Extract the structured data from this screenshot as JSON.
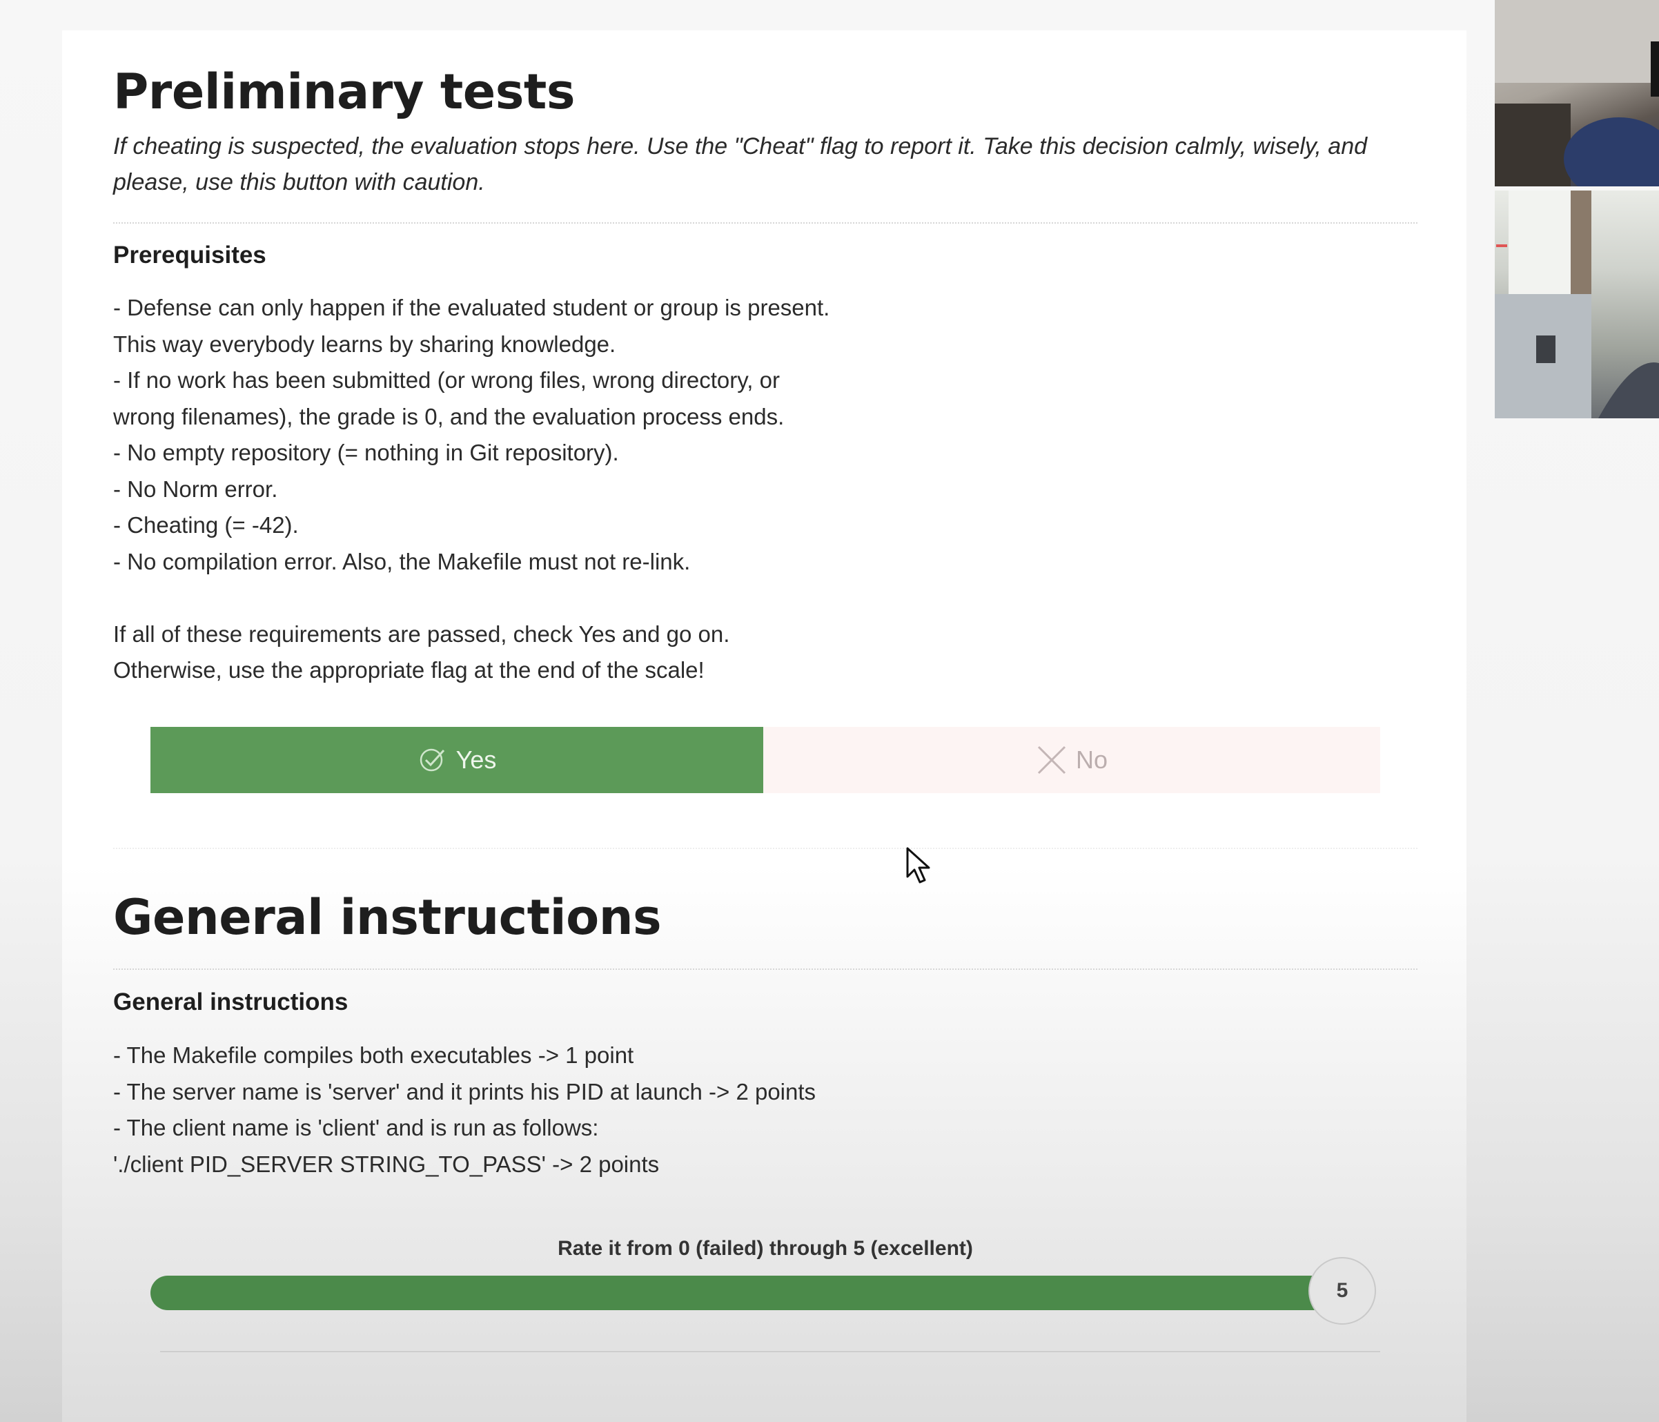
{
  "preliminary": {
    "title": "Preliminary tests",
    "intro": "If cheating is suspected, the evaluation stops here. Use the \"Cheat\" flag to report it. Take this decision calmly, wisely, and please, use this button with caution.",
    "subheading": "Prerequisites",
    "lines": [
      "- Defense can only happen if the evaluated student or group is present.",
      "This way everybody learns by sharing knowledge.",
      "- If no work has been submitted (or wrong files, wrong directory, or",
      "wrong filenames), the grade is 0, and the evaluation process ends.",
      "- No empty repository (= nothing in Git repository).",
      "- No Norm error.",
      "- Cheating (= -42).",
      "- No compilation error. Also, the Makefile must not re-link.",
      "",
      "If all of these requirements are passed, check Yes and go on.",
      "Otherwise, use the appropriate flag at the end of the scale!"
    ],
    "yes_label": "Yes",
    "no_label": "No",
    "selected": "Yes"
  },
  "general": {
    "title": "General instructions",
    "subheading": "General instructions",
    "lines": [
      "- The Makefile compiles both executables -> 1 point",
      "- The server name is 'server' and it prints his PID at launch -> 2 points",
      "- The client name is 'client' and is run as follows:",
      "'./client PID_SERVER STRING_TO_PASS' -> 2 points"
    ],
    "rating_label": "Rate it from 0 (failed) through 5 (excellent)",
    "rating_value": "5",
    "rating_fraction": 1.0
  },
  "colors": {
    "yes_green": "#5c9a58",
    "slider_green": "#4b8a4a",
    "no_bg": "#fdf4f3"
  },
  "icons": [
    "check-icon",
    "cross-icon",
    "mouse-cursor-icon"
  ]
}
